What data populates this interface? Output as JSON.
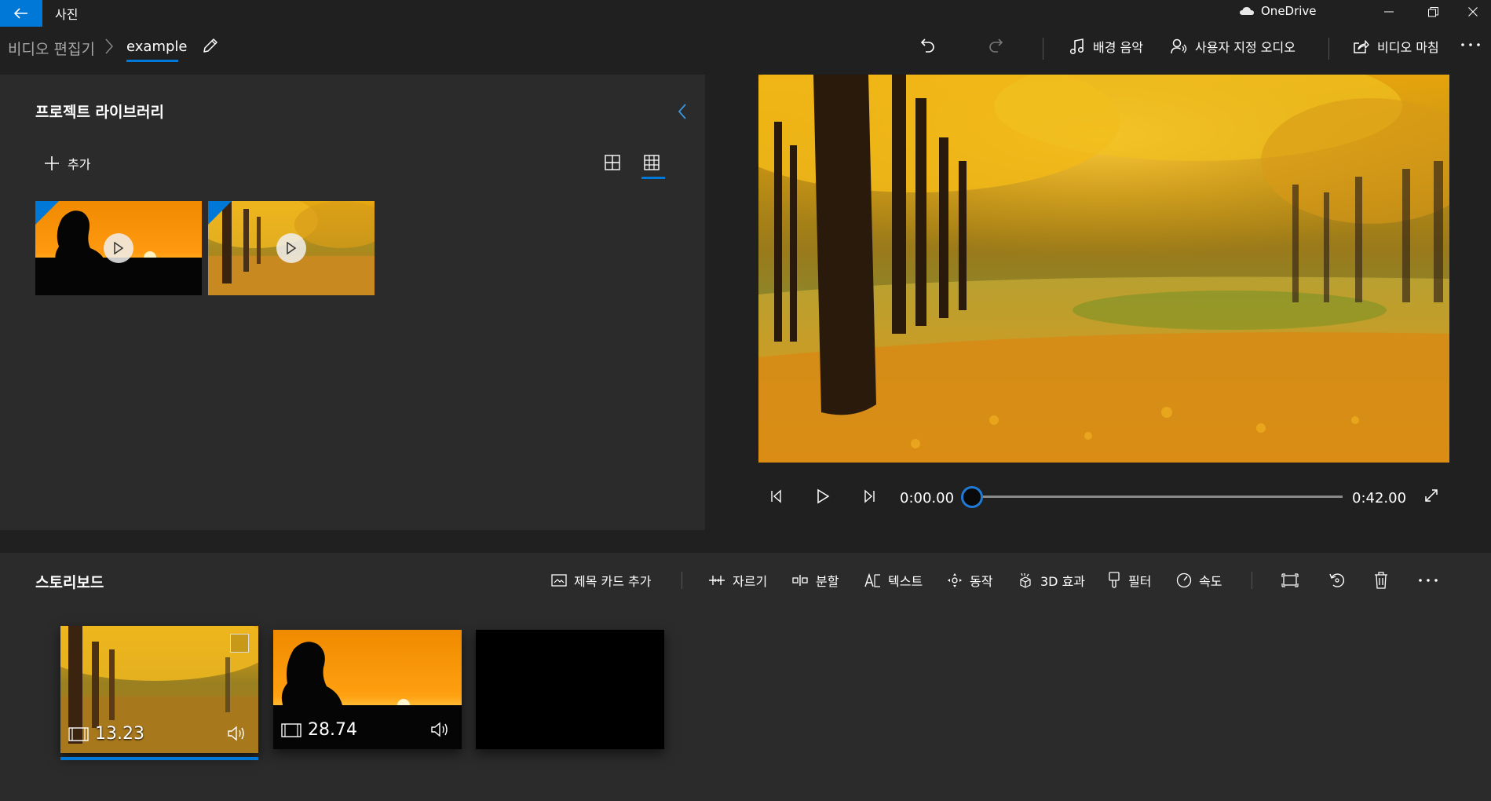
{
  "window": {
    "app_title": "사진",
    "onedrive_label": "OneDrive"
  },
  "breadcrumb": {
    "root": "비디오 편집기",
    "current": "example"
  },
  "commands": {
    "background_music": "배경 음악",
    "custom_audio": "사용자 지정 오디오",
    "finish_video": "비디오 마침"
  },
  "library": {
    "title": "프로젝트 라이브러리",
    "add_label": "추가"
  },
  "player": {
    "current_time": "0:00.00",
    "total_time": "0:42.00",
    "progress": 0
  },
  "storyboard": {
    "title": "스토리보드",
    "tools": {
      "add_title_card": "제목 카드 추가",
      "trim": "자르기",
      "split": "분할",
      "text": "텍스트",
      "motion": "동작",
      "effects_3d": "3D 효과",
      "filters": "필터",
      "speed": "속도"
    },
    "clips": [
      {
        "duration": "13.23"
      },
      {
        "duration": "28.74"
      }
    ]
  },
  "colors": {
    "accent": "#0078d7",
    "background": "#202020",
    "panel": "#2b2b2b"
  }
}
